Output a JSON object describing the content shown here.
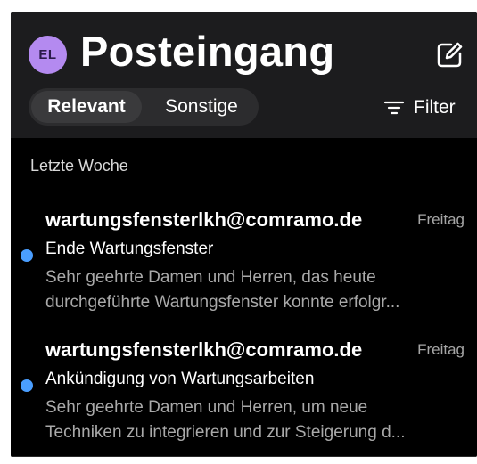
{
  "header": {
    "avatar_initials": "EL",
    "title": "Posteingang",
    "compose_icon": "compose-icon"
  },
  "tabs": [
    {
      "label": "Relevant",
      "selected": true
    },
    {
      "label": "Sonstige",
      "selected": false
    }
  ],
  "filter": {
    "label": "Filter",
    "icon": "filter-icon"
  },
  "section_label": "Letzte Woche",
  "emails": [
    {
      "sender": "wartungsfensterlkh@comramo.de",
      "date": "Freitag",
      "subject": "Ende Wartungsfenster",
      "preview_line1": "Sehr geehrte Damen und Herren, das heute",
      "preview_line2": "durchgeführte Wartungsfenster konnte erfolgr...",
      "unread": true
    },
    {
      "sender": "wartungsfensterlkh@comramo.de",
      "date": "Freitag",
      "subject": "Ankündigung von Wartungsarbeiten",
      "preview_line1": "Sehr geehrte Damen und Herren, um neue",
      "preview_line2": "Techniken zu integrieren und zur Steigerung d...",
      "unread": true
    }
  ],
  "colors": {
    "background": "#000000",
    "header_background": "#1c1c1e",
    "avatar": "#b48af0",
    "unread_dot": "#4a9eff"
  }
}
